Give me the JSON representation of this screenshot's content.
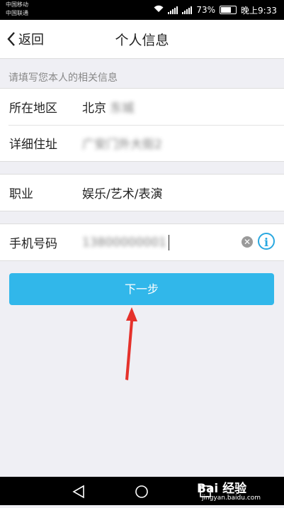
{
  "status_bar": {
    "carrier1": "中国移动",
    "carrier2": "中国联通",
    "battery": "73%",
    "time": "晚上9:33"
  },
  "header": {
    "back_label": "返回",
    "title": "个人信息"
  },
  "form": {
    "hint": "请填写您本人的相关信息",
    "region": {
      "label": "所在地区",
      "value": "北京",
      "blurred": "东城"
    },
    "address": {
      "label": "详细住址",
      "blurred": "广安门外大街2"
    },
    "occupation": {
      "label": "职业",
      "value": "娱乐/艺术/表演"
    },
    "phone": {
      "label": "手机号码",
      "blurred": "13800000001"
    }
  },
  "next_button": {
    "label": "下一步"
  },
  "watermark": {
    "brand": "Bai 经验",
    "url": "jingyan.baidu.com"
  },
  "colors": {
    "accent": "#31b7ea",
    "info": "#29a8e0",
    "arrow": "#e5312b"
  }
}
